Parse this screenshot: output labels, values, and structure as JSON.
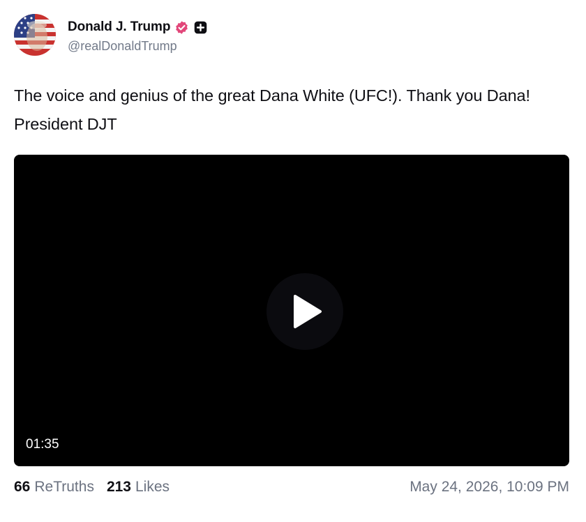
{
  "author": {
    "display_name": "Donald J. Trump",
    "handle": "@realDonaldTrump",
    "verified_badge_color": "#e2477a",
    "plus_badge_color": "#0f0f14"
  },
  "post": {
    "text": "The voice and genius of the great Dana White (UFC!). Thank you Dana! President DJT"
  },
  "video": {
    "duration": "01:35",
    "play_icon": "play-icon"
  },
  "stats": {
    "retruths_count": "66",
    "retruths_label": "ReTruths",
    "likes_count": "213",
    "likes_label": "Likes",
    "timestamp": "May 24, 2026, 10:09 PM"
  }
}
